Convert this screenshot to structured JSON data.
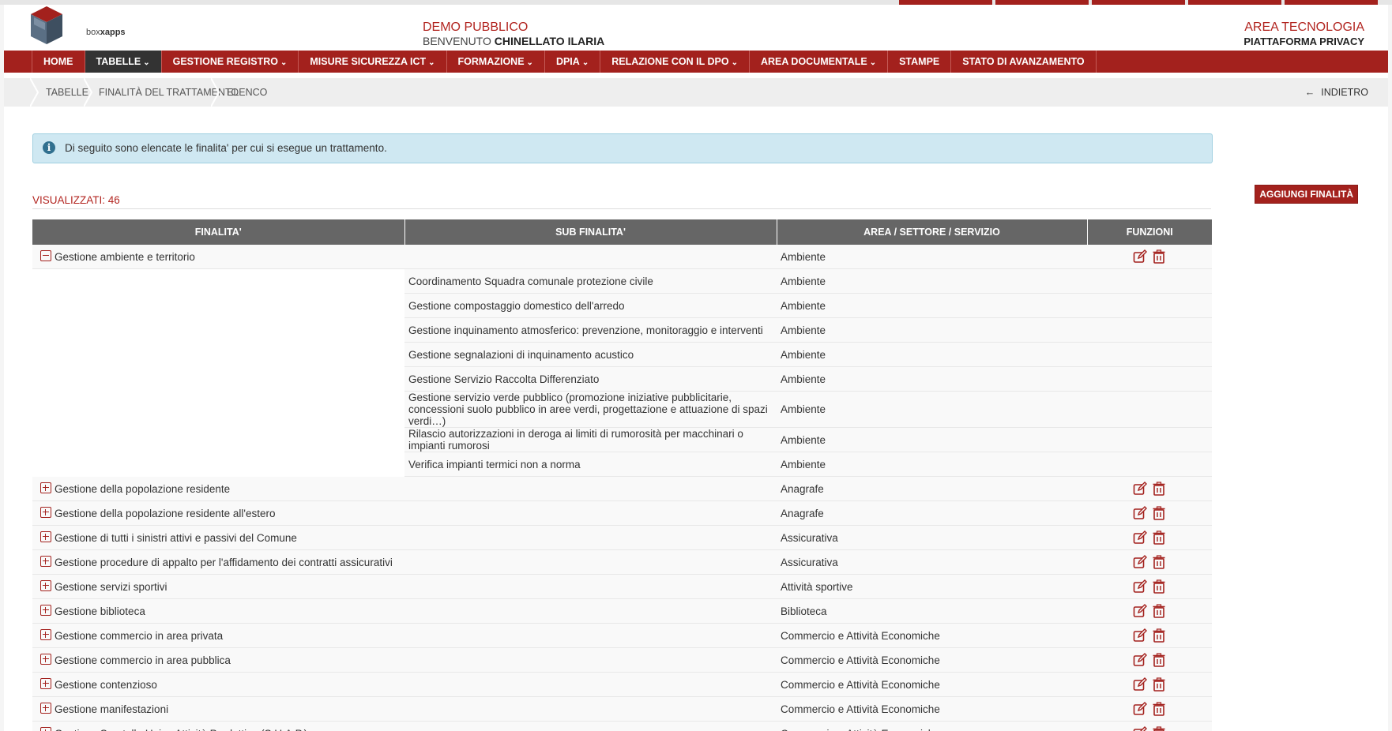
{
  "header": {
    "logo_text_light": "box",
    "logo_text_bold": "xapps",
    "demo": "DEMO PUBBLICO",
    "welcome_prefix": "BENVENUTO",
    "user": "CHINELLATO ILARIA",
    "area": "AREA TECNOLOGIA",
    "platform": "PIATTAFORMA PRIVACY"
  },
  "nav": [
    {
      "label": "HOME"
    },
    {
      "label": "TABELLE",
      "caret": "⌄"
    },
    {
      "label": "GESTIONE REGISTRO",
      "caret": "⌄"
    },
    {
      "label": "MISURE SICUREZZA ICT",
      "caret": "⌄"
    },
    {
      "label": "FORMAZIONE",
      "caret": "⌄"
    },
    {
      "label": "DPIA",
      "caret": "⌄"
    },
    {
      "label": "RELAZIONE CON IL DPO",
      "caret": "⌄"
    },
    {
      "label": "AREA DOCUMENTALE",
      "caret": "⌄"
    },
    {
      "label": "STAMPE"
    },
    {
      "label": "STATO DI AVANZAMENTO"
    }
  ],
  "breadcrumb": {
    "items": [
      "TABELLE",
      "FINALITÀ DEL TRATTAMENTO",
      "ELENCO"
    ],
    "back": "INDIETRO",
    "back_arrow": "←"
  },
  "info": {
    "icon": "i",
    "text": "Di seguito sono elencate le finalita' per cui si esegue un trattamento."
  },
  "list": {
    "count": "VISUALIZZATI: 46",
    "add_button": "AGGIUNGI FINALITÀ"
  },
  "table": {
    "headers": [
      "FINALITA'",
      "SUB FINALITA'",
      "AREA / SETTORE / SERVIZIO",
      "FUNZIONI"
    ],
    "rows": [
      {
        "type": "group",
        "expanded": true,
        "finalita": "Gestione ambiente e territorio",
        "area": "Ambiente"
      },
      {
        "type": "sub",
        "sub": "Coordinamento Squadra comunale protezione civile",
        "area": "Ambiente"
      },
      {
        "type": "sub",
        "sub": "Gestione compostaggio domestico dell'arredo",
        "area": "Ambiente"
      },
      {
        "type": "sub",
        "sub": "Gestione inquinamento atmosferico: prevenzione, monitoraggio e interventi",
        "area": "Ambiente"
      },
      {
        "type": "sub",
        "sub": "Gestione segnalazioni di inquinamento acustico",
        "area": "Ambiente"
      },
      {
        "type": "sub",
        "sub": "Gestione Servizio Raccolta Differenziato",
        "area": "Ambiente"
      },
      {
        "type": "sub",
        "tall": true,
        "sub": "Gestione servizio verde pubblico (promozione iniziative pubblicitarie, concessioni suolo pubblico in aree verdi, progettazione e attuazione di spazi verdi…)",
        "area": "Ambiente"
      },
      {
        "type": "sub",
        "sub": "Rilascio autorizzazioni in deroga ai limiti di rumorosità per macchinari o impianti rumorosi",
        "area": "Ambiente"
      },
      {
        "type": "sub",
        "sub": "Verifica impianti termici non a norma",
        "area": "Ambiente"
      },
      {
        "type": "group",
        "expanded": false,
        "finalita": "Gestione della popolazione residente",
        "area": "Anagrafe"
      },
      {
        "type": "group",
        "expanded": false,
        "finalita": "Gestione della popolazione residente all'estero",
        "area": "Anagrafe"
      },
      {
        "type": "group",
        "expanded": false,
        "finalita": "Gestione di tutti i sinistri attivi e passivi del Comune",
        "area": "Assicurativa"
      },
      {
        "type": "group",
        "expanded": false,
        "finalita": "Gestione procedure di appalto per l'affidamento dei contratti assicurativi",
        "area": "Assicurativa"
      },
      {
        "type": "group",
        "expanded": false,
        "finalita": "Gestione servizi sportivi",
        "area": "Attività sportive"
      },
      {
        "type": "group",
        "expanded": false,
        "finalita": "Gestione biblioteca",
        "area": "Biblioteca"
      },
      {
        "type": "group",
        "expanded": false,
        "finalita": "Gestione commercio in area privata",
        "area": "Commercio e Attività Economiche"
      },
      {
        "type": "group",
        "expanded": false,
        "finalita": "Gestione commercio in area pubblica",
        "area": "Commercio e Attività Economiche"
      },
      {
        "type": "group",
        "expanded": false,
        "finalita": "Gestione contenzioso",
        "area": "Commercio e Attività Economiche"
      },
      {
        "type": "group",
        "expanded": false,
        "finalita": "Gestione manifestazioni",
        "area": "Commercio e Attività Economiche"
      },
      {
        "type": "group",
        "expanded": false,
        "finalita": "Gestione Sportello Unico Attività Produttive (S.U.A.P.)",
        "area": "Commercio e Attività Economiche"
      }
    ]
  },
  "colors": {
    "brand": "#a3211d",
    "header_gray": "#666666",
    "info_bg": "#cfe8f2"
  },
  "icons": {
    "edit": "edit-icon",
    "delete": "trash-icon",
    "expand": "plus-square-icon",
    "collapse": "minus-square-icon",
    "info": "info-circle-icon",
    "back": "arrow-left-icon",
    "logo": "cube-logo-icon"
  }
}
